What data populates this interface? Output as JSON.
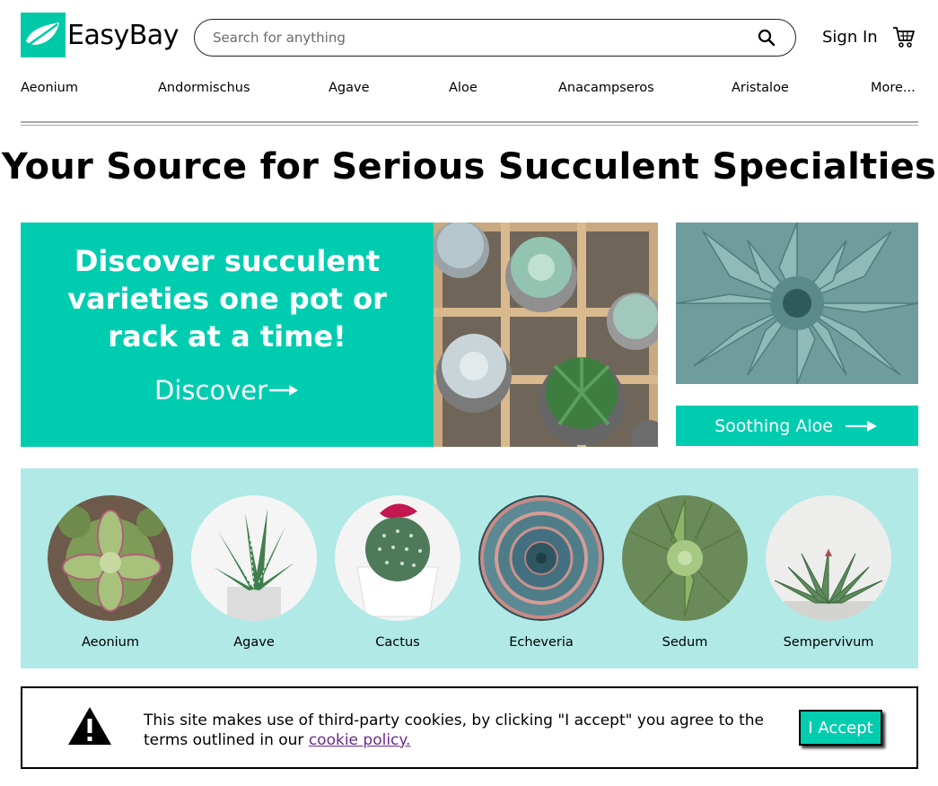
{
  "brand": {
    "name": "EasyBay",
    "accent": "#00cdb0"
  },
  "search": {
    "placeholder": "Search for anything"
  },
  "header": {
    "sign_in": "Sign In"
  },
  "categories": [
    "Aeonium",
    "Andormischus",
    "Agave",
    "Aloe",
    "Anacampseros",
    "Aristaloe",
    "More..."
  ],
  "headline": "Your Source for Serious Succulent Specialties",
  "hero": {
    "title": "Discover succulent varieties one pot or rack at a time!",
    "cta": "Discover"
  },
  "side": {
    "button": "Soothing Aloe"
  },
  "featured": [
    {
      "label": "Aeonium"
    },
    {
      "label": "Agave"
    },
    {
      "label": "Cactus"
    },
    {
      "label": "Echeveria"
    },
    {
      "label": "Sedum"
    },
    {
      "label": "Sempervivum"
    }
  ],
  "cookie": {
    "text": "This site makes use of third-party cookies, by clicking \"I accept\" you agree to the terms outlined in our",
    "link": "cookie policy.",
    "accept": "I Accept"
  }
}
